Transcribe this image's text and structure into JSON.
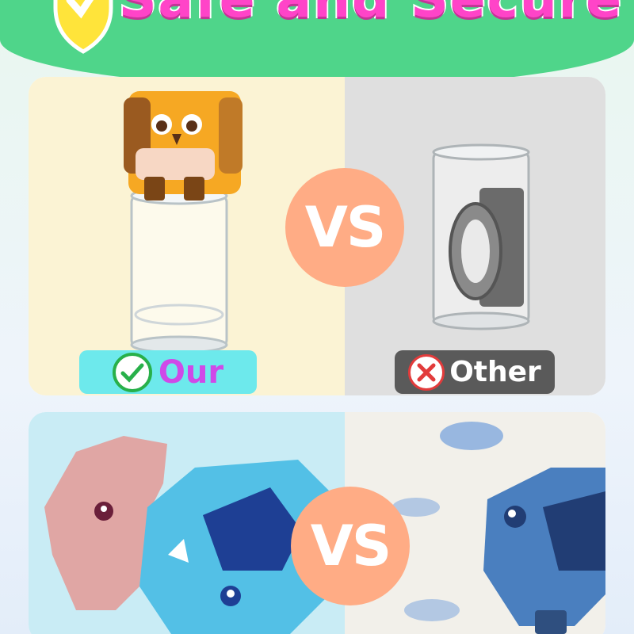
{
  "header": {
    "title": "Safe and Secure",
    "shield_icon": "shield-check-icon"
  },
  "comparison_top": {
    "left_label": "Our",
    "right_label": "Other",
    "vs": "VS",
    "left_icon": "check-icon",
    "right_icon": "x-icon"
  },
  "comparison_bottom": {
    "vs": "VS"
  },
  "colors": {
    "header_green": "#4fd58a",
    "title_pink": "#ff44c8",
    "vs_orange": "#ffac85",
    "our_bg": "#6de9ec",
    "our_text": "#cf49e8",
    "other_bg": "#5a5a5a"
  }
}
